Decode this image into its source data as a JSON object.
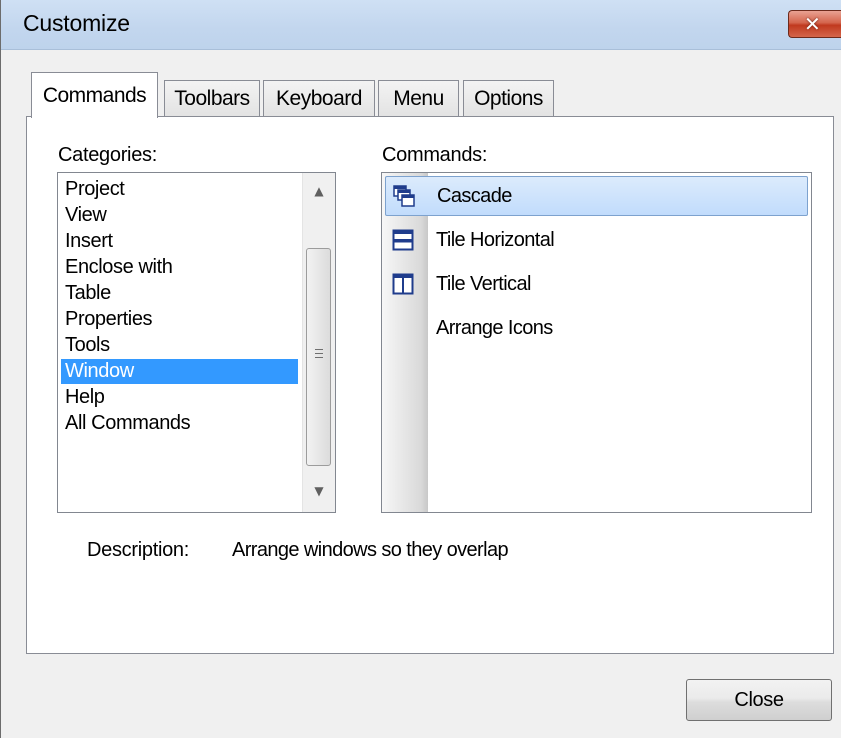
{
  "window": {
    "title": "Customize",
    "close_glyph": "✕"
  },
  "tabs": [
    {
      "label": "Commands",
      "active": true
    },
    {
      "label": "Toolbars",
      "active": false
    },
    {
      "label": "Keyboard",
      "active": false
    },
    {
      "label": "Menu",
      "active": false
    },
    {
      "label": "Options",
      "active": false
    }
  ],
  "categories": {
    "label": "Categories:",
    "items": [
      "Project",
      "View",
      "Insert",
      "Enclose with",
      "Table",
      "Properties",
      "Tools",
      "Window",
      "Help",
      "All Commands"
    ],
    "selected": "Window",
    "scroll_up_glyph": "▲",
    "scroll_down_glyph": "▼"
  },
  "commands": {
    "label": "Commands:",
    "items": [
      {
        "label": "Cascade",
        "icon": "cascade-windows-icon",
        "selected": true
      },
      {
        "label": "Tile Horizontal",
        "icon": "tile-horizontal-icon",
        "selected": false
      },
      {
        "label": "Tile Vertical",
        "icon": "tile-vertical-icon",
        "selected": false
      },
      {
        "label": "Arrange Icons",
        "icon": "",
        "selected": false
      }
    ]
  },
  "description": {
    "label": "Description:",
    "value": "Arrange windows so they overlap"
  },
  "buttons": {
    "close_label": "Close"
  },
  "colors": {
    "selection_blue": "#3399ff",
    "titlebar": "#c2d6ee",
    "close_button_red": "#c0391f",
    "icon_navy": "#1f3c8c"
  }
}
